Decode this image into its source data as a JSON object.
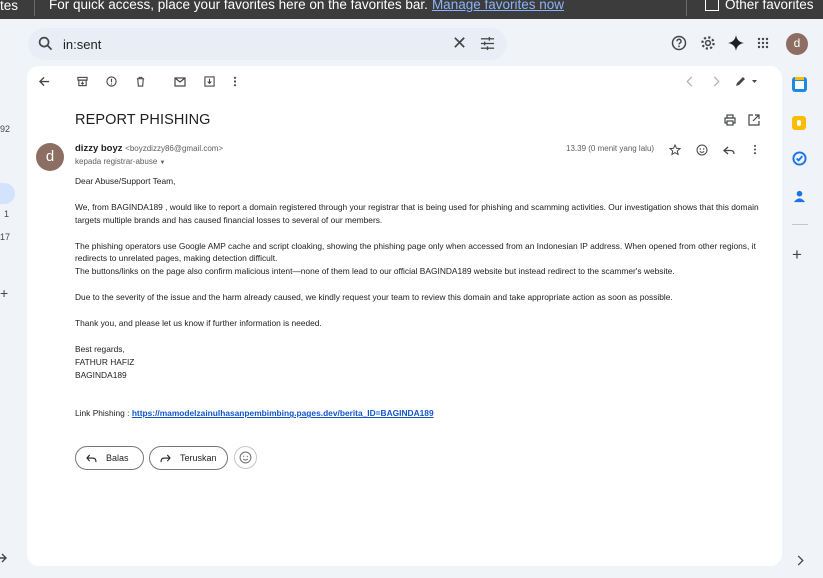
{
  "favorites_bar": {
    "left_fragment": "tes",
    "message": "For quick access, place your favorites here on the favorites bar.",
    "manage_link": "Manage favorites now",
    "other_favorites": "Other favorites"
  },
  "search": {
    "value": "in:sent"
  },
  "user": {
    "initial": "d"
  },
  "gutter": {
    "count_a": "92",
    "count_b": "1",
    "count_c": "17"
  },
  "email": {
    "subject": "REPORT PHISHING",
    "sender_name": "dizzy boyz",
    "sender_email": "<boyzdizzy86@gmail.com>",
    "recipient": "kepada registrar-abuse",
    "time": "13.39 (0 menit yang lalu)",
    "avatar_initial": "d",
    "greeting": "Dear Abuse/Support Team,",
    "para1": "We, from BAGINDA189 , would like to report a domain registered through your registrar that is being used for phishing and scamming activities. Our investigation shows that this domain targets multiple brands and has caused financial losses to several of our members.",
    "para2a": "The phishing operators use Google AMP cache and script cloaking, showing the phishing page only when accessed from an Indonesian IP address. When opened from other regions, it redirects to unrelated pages, making detection difficult.",
    "para2b": "The buttons/links on the page also confirm malicious intent—none of them lead to our official BAGINDA189 website but instead redirect to the scammer's website.",
    "para3": "Due to the severity of the issue and the harm already caused, we kindly request your team to review this domain and take appropriate action as soon as possible.",
    "para4": "Thank you, and please let us know if further information is needed.",
    "regards": "Best regards,",
    "sig_name": "FATHUR HAFIZ",
    "sig_org": "BAGINDA189",
    "link_label": "Link Phishing :",
    "link_url": "https://mamodelzainulhasanpembimbing.pages.dev/berita_ID=BAGINDA189"
  },
  "actions": {
    "reply": "Balas",
    "forward": "Teruskan"
  },
  "colors": {
    "accent_blue": "#1155cc",
    "avatar_brown": "#8d6e63",
    "favbar_bg": "#3c3c3c",
    "page_bg": "#f0f4f9"
  }
}
